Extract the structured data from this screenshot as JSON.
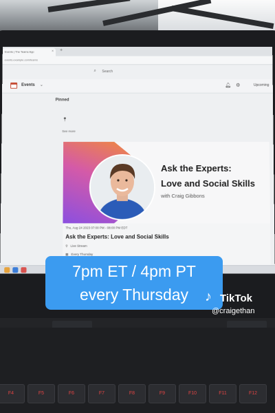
{
  "browser": {
    "tab_label": "Events | The Teams App",
    "address": "events.example.com/teams",
    "new_tab": "+"
  },
  "app": {
    "search_placeholder": "Search",
    "section_title": "Events",
    "upcoming_label": "Upcoming",
    "pinned_label": "Pinned",
    "see_more": "See more"
  },
  "event": {
    "headline_line1": "Ask the Experts:",
    "headline_line2": "Love and Social Skills",
    "with_host": "with Craig Gibbons",
    "datetime": "Thu, Aug 24 2023 07:00 PM - 08:00 PM EDT",
    "title": "Ask the Experts: Love and Social Skills",
    "location": "Live Stream",
    "recurrence": "Every Thursday"
  },
  "overlay": {
    "line1": "7pm ET / 4pm PT",
    "line2": "every Thursday",
    "brand": "TikTok",
    "handle": "@craigethan"
  },
  "keyboard": {
    "fkeys": [
      "F4",
      "F5",
      "F6",
      "F7",
      "F8",
      "F9",
      "F10",
      "F11",
      "F12"
    ]
  },
  "icons": {
    "calendar": "calendar-icon",
    "bell": "bell-icon",
    "gear": "gear-icon",
    "pin": "pin-icon",
    "search": "search-icon",
    "music-note": "tiktok-logo-icon"
  },
  "colors": {
    "caption_bg": "#3b9bf0",
    "banner_grad_start": "#f08a3c",
    "banner_grad_end": "#8b4fe0",
    "key_legend": "#e04444"
  }
}
